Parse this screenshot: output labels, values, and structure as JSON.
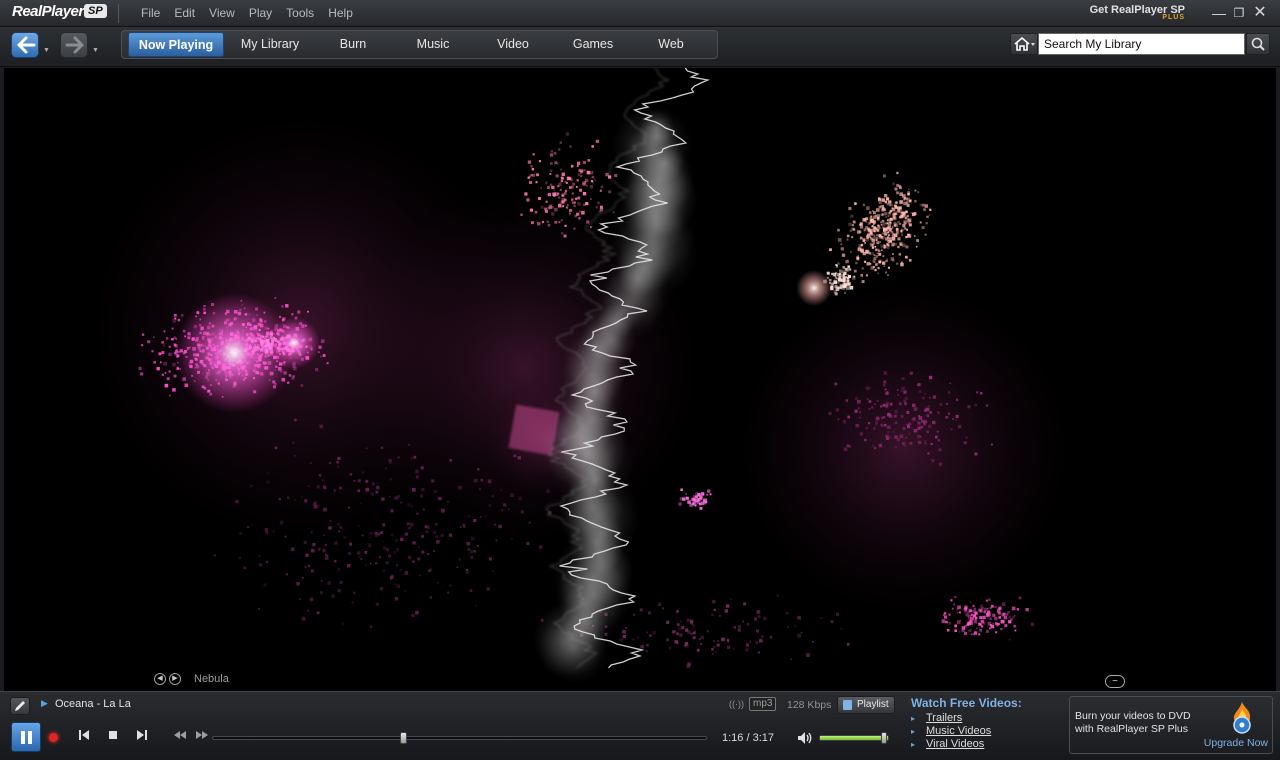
{
  "app": {
    "logo_text": "RealPlayer",
    "logo_badge": "SP",
    "get_sp_label": "Get RealPlayer SP",
    "get_sp_plus": "PLUS"
  },
  "menu": [
    "File",
    "Edit",
    "View",
    "Play",
    "Tools",
    "Help"
  ],
  "tabs": [
    "Now Playing",
    "My Library",
    "Burn",
    "Music",
    "Video",
    "Games",
    "Web"
  ],
  "active_tab": "Now Playing",
  "search": {
    "placeholder": "Search My Library",
    "value": "Search My Library"
  },
  "visualization": {
    "name": "Nebula"
  },
  "player": {
    "track": "Oceana - La La",
    "format": "mp3",
    "bitrate": "128 Kbps",
    "playlist_label": "Playlist",
    "elapsed": "1:16",
    "duration": "3:17",
    "time_display": "1:16 / 3:17",
    "progress": 0.386,
    "volume": 1.0
  },
  "free_videos": {
    "title": "Watch Free Videos:",
    "links": [
      "Trailers",
      "Music Videos",
      "Viral Videos"
    ]
  },
  "upsell": {
    "text": "Burn your videos to DVD with RealPlayer SP Plus",
    "link": "Upgrade Now"
  },
  "colors": {
    "accent": "#3a7cc4",
    "link": "#7fb1e4",
    "record": "#e0261e",
    "volume": "#8fd13b",
    "particle_pink": "#ff4fd0",
    "particle_peach": "#ffb0a8"
  }
}
